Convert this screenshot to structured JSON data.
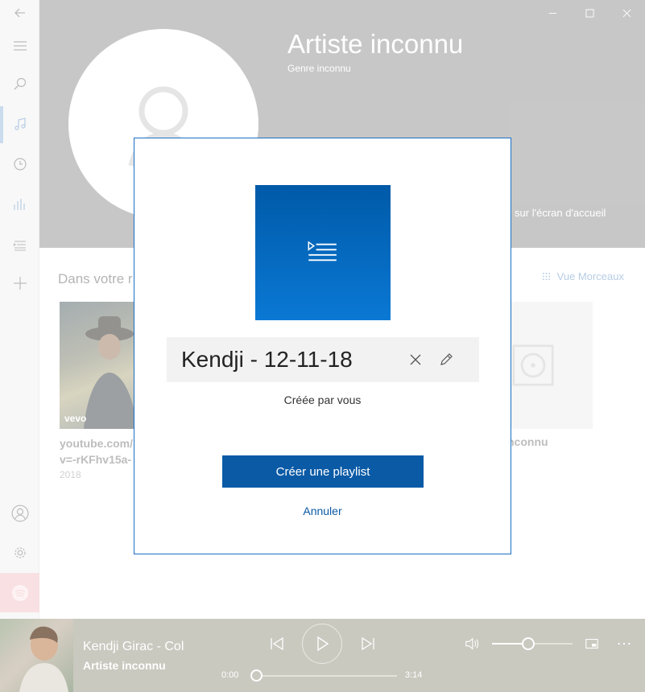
{
  "header": {
    "artist_name": "Artiste inconnu",
    "genre": "Genre inconnu",
    "pin_label": "ler sur l'écran d'accueil"
  },
  "content": {
    "section_title": "Dans votre r",
    "view_link": "Vue Morceaux",
    "items": [
      {
        "title": "youtube.com/ v=-rKFhv15a-",
        "year": "2018",
        "badge": "vevo"
      },
      {
        "title": "nconnu"
      }
    ]
  },
  "dialog": {
    "playlist_name": "Kendji - 12-11-18",
    "created_by": "Créée par vous",
    "create_button": "Créer une playlist",
    "cancel_link": "Annuler",
    "accent_color": "#0a5aa6"
  },
  "player": {
    "track_title": "Kendji Girac - Col",
    "track_artist": "Artiste inconnu",
    "time_elapsed": "0:00",
    "time_total": "3:14",
    "seek_progress": 0,
    "volume": 0.45
  },
  "icons": {
    "rail": [
      "back-arrow-icon",
      "hamburger-icon",
      "search-icon",
      "music-note-icon",
      "clock-icon",
      "equalizer-icon",
      "playlist-icon",
      "plus-icon",
      "user-icon",
      "gear-icon",
      "spotify-icon"
    ]
  }
}
